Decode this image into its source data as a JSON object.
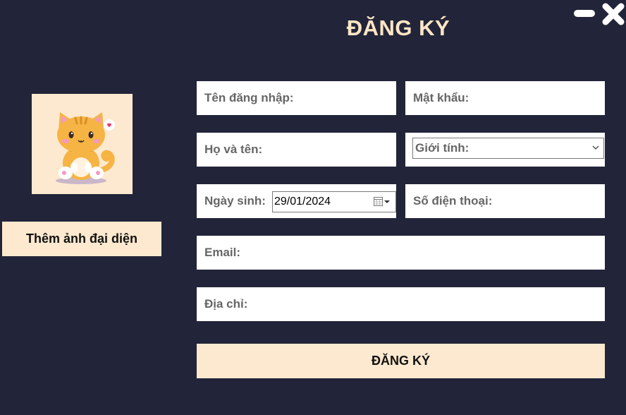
{
  "window": {
    "minimize_icon": "minimize-icon",
    "close_icon": "close-icon"
  },
  "title": "ĐĂNG KÝ",
  "avatar": {
    "image": "cat-avatar",
    "button_label": "Thêm ảnh đại diện"
  },
  "form": {
    "username_label": "Tên đăng nhập:",
    "password_label": "Mật khẩu:",
    "fullname_label": "Họ và tên:",
    "gender_label": "Giới tính:",
    "dob_label": "Ngày sinh:",
    "dob_value": "29/01/2024",
    "phone_label": "Số điện thoại:",
    "email_label": "Email:",
    "address_label": "Địa chỉ:"
  },
  "submit_label": "ĐĂNG KÝ",
  "colors": {
    "background": "#222539",
    "accent": "#fde9cf",
    "title": "#fde6c5",
    "field_label": "#666666"
  }
}
